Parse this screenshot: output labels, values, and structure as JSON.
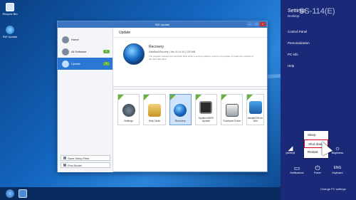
{
  "window": {
    "title": "SW Update",
    "controls": [
      "–",
      "□",
      "×"
    ]
  },
  "sidebar": {
    "items": [
      {
        "label": "Home"
      },
      {
        "label": "All Software",
        "badge": "5"
      },
      {
        "label": "Update",
        "badge": "5"
      }
    ],
    "bottom_buttons": [
      "Save Setup Files",
      "Find Model"
    ]
  },
  "content": {
    "section_title": "Update",
    "detail": {
      "name": "Recovery",
      "meta": "SafeBackSecurity  |  Ver. 6.0.6.10  |  120 MB",
      "description": "The program restores the hard disk drive when a serious problem occurs in the system or loads the contents of the hard disk drive."
    },
    "tiles": [
      {
        "label": "Settings"
      },
      {
        "label": "Help Desk"
      },
      {
        "label": "Recovery"
      },
      {
        "label": "System BIOS Update"
      },
      {
        "label": "Touchpad Driver"
      },
      {
        "label": "MediaSOft for Win"
      }
    ]
  },
  "charms": {
    "title": "Settings",
    "subtitle": "Desktop",
    "machine_name": "SS-114(E)",
    "links": [
      "Control Panel",
      "Personalization",
      "PC info",
      "Help"
    ],
    "quick": [
      {
        "label": "iptime@",
        "icon": "wifi-icon"
      },
      {
        "label": "",
        "icon": "volume-icon"
      },
      {
        "label": "Brightness",
        "icon": "brightness-icon"
      },
      {
        "label": "Notifications",
        "icon": "notifications-icon"
      },
      {
        "label": "Power",
        "icon": "power-icon"
      },
      {
        "label": "Keyboard",
        "icon": "keyboard-icon",
        "value": "ENG"
      }
    ],
    "power_menu": [
      "Sleep",
      "Shut down",
      "Restart"
    ],
    "change_pc_settings": "Change PC settings"
  },
  "desktop": {
    "icons": [
      "Recycle Bin",
      "SW Update"
    ]
  },
  "colors": {
    "accent": "#2a77d4",
    "charms_bg": "#1b2a78",
    "badge": "#69b23c"
  }
}
